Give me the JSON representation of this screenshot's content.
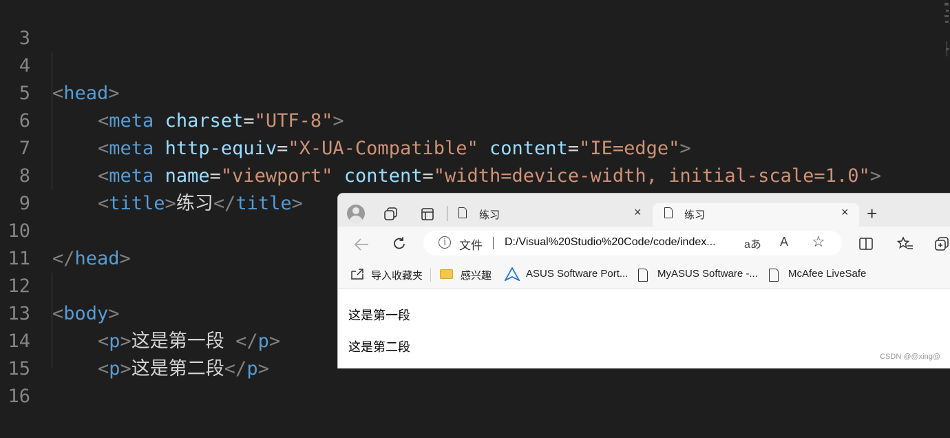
{
  "editor": {
    "line_numbers": [
      "3",
      "4",
      "5",
      "6",
      "7",
      "8",
      "9",
      "10",
      "11",
      "12",
      "13",
      "14",
      "15",
      "16"
    ],
    "lines": {
      "l4": {
        "lt": "<",
        "tag": "head",
        "gt": ">"
      },
      "l5": {
        "lt": "<",
        "tag": "meta",
        "attr1": "charset",
        "eq1": "=",
        "val1": "\"UTF-8\"",
        "gt": ">"
      },
      "l6": {
        "lt": "<",
        "tag": "meta",
        "attr1": "http-equiv",
        "eq1": "=",
        "val1": "\"X-UA-Compatible\"",
        "attr2": "content",
        "eq2": "=",
        "val2": "\"IE=edge\"",
        "gt": ">"
      },
      "l7": {
        "lt": "<",
        "tag": "meta",
        "attr1": "name",
        "eq1": "=",
        "val1": "\"viewport\"",
        "attr2": "content",
        "eq2": "=",
        "val2": "\"width=device-width, initial-scale=1.0\"",
        "gt": ">"
      },
      "l8": {
        "lt": "<",
        "tag": "title",
        "gt": ">",
        "text": "练习",
        "clt": "</",
        "gt2": ">"
      },
      "l10": {
        "lt": "</",
        "tag": "head",
        "gt": ">"
      },
      "l12": {
        "lt": "<",
        "tag": "body",
        "gt": ">"
      },
      "l13": {
        "lt": "<",
        "tag": "p",
        "gt": ">",
        "text": "这是第一段 ",
        "clt": "</",
        "gt2": ">"
      },
      "l14": {
        "lt": "<",
        "tag": "p",
        "gt": ">",
        "text": "这是第二段",
        "clt": "</",
        "gt2": ">"
      }
    }
  },
  "browser": {
    "tabs": [
      {
        "title": "练习",
        "close": "×"
      },
      {
        "title": "练习",
        "close": "×"
      }
    ],
    "new_tab": "+",
    "address": {
      "label": "文件",
      "url": "D:/Visual%20Studio%20Code/code/index...",
      "info_glyph": "i",
      "read_aloud_glyph": "aあ",
      "font_glyph": "A",
      "star_glyph": "☆"
    },
    "favorites": [
      {
        "label": "导入收藏夹"
      },
      {
        "label": "感兴趣"
      },
      {
        "label": "ASUS Software Port..."
      },
      {
        "label": "MyASUS Software -..."
      },
      {
        "label": "McAfee LiveSafe"
      }
    ],
    "content": {
      "p1": "这是第一段",
      "p2": "这是第二段"
    }
  },
  "watermark": "CSDN @@xing@",
  "colors": {
    "editor_bg": "#1e1e1e",
    "tag": "#569cd6",
    "attribute": "#9cdcfe",
    "string": "#ce9178",
    "bracket": "#808080",
    "text": "#d4d4d4",
    "line_number": "#858585"
  }
}
